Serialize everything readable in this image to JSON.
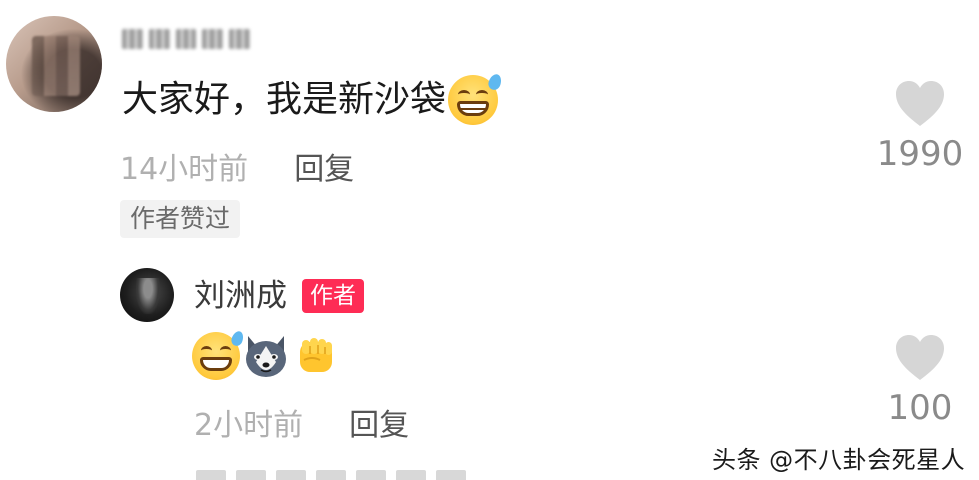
{
  "comment": {
    "username": "某道某某",
    "text": "大家好，我是新沙袋",
    "time": "14小时前",
    "reply_label": "回复",
    "author_liked_tag": "作者赞过",
    "likes": "1990",
    "emoji": "grin-sweat-emoji"
  },
  "reply": {
    "username": "刘洲成",
    "author_badge": "作者",
    "emojis": [
      "grin-sweat-emoji",
      "husky-dog-emoji",
      "fist-emoji"
    ],
    "time": "2小时前",
    "reply_label": "回复",
    "likes": "100"
  },
  "watermark": "头条 @不八卦会死星人",
  "colors": {
    "author_badge_bg": "#fe2c55",
    "heart": "#d6d6d6",
    "meta_text": "#a8a8a8"
  }
}
